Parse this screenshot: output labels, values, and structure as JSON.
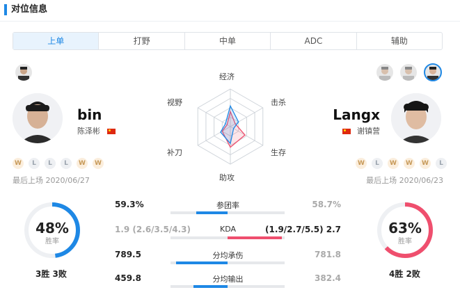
{
  "section_title": "对位信息",
  "tabs": [
    {
      "label": "上单",
      "active": true
    },
    {
      "label": "打野",
      "active": false
    },
    {
      "label": "中单",
      "active": false
    },
    {
      "label": "ADC",
      "active": false
    },
    {
      "label": "辅助",
      "active": false
    }
  ],
  "left_player": {
    "name": "bin",
    "real_name": "陈泽彬",
    "recent": [
      "W",
      "L",
      "L",
      "L",
      "W",
      "W"
    ],
    "last_played": "最后上场 2020/06/27",
    "win_rate": "48%",
    "win_rate_value": 0.48,
    "win_rate_label": "胜率",
    "record": "3胜 3败",
    "color": "#1e88e5"
  },
  "right_player": {
    "name": "Langx",
    "real_name": "谢镇营",
    "recent": [
      "W",
      "L",
      "W",
      "W",
      "W",
      "L"
    ],
    "last_played": "最后上场 2020/06/23",
    "win_rate": "63%",
    "win_rate_value": 0.63,
    "win_rate_label": "胜率",
    "record": "4胜 2败",
    "color": "#ef4f6e"
  },
  "radar": {
    "axes": [
      "经济",
      "击杀",
      "生存",
      "助攻",
      "补刀",
      "视野"
    ],
    "left_values": [
      0.55,
      0.25,
      0.1,
      0.45,
      0.3,
      0.15
    ],
    "right_values": [
      0.4,
      0.15,
      0.45,
      0.55,
      0.25,
      0.1
    ]
  },
  "stats": [
    {
      "name": "参团率",
      "left": "59.3%",
      "right": "58.7%",
      "left_fill": 0.55,
      "right_fill": 0.0
    },
    {
      "name": "KDA",
      "left": "1.9 (2.6/3.5/4.3)",
      "right": "(1.9/2.7/5.5) 2.7",
      "left_fill": 0.0,
      "right_fill": 0.95
    },
    {
      "name": "分均承伤",
      "left": "789.5",
      "right": "781.8",
      "left_fill": 0.9,
      "right_fill": 0.0
    },
    {
      "name": "分均输出",
      "left": "459.8",
      "right": "382.4",
      "left_fill": 0.6,
      "right_fill": 0.0
    }
  ]
}
